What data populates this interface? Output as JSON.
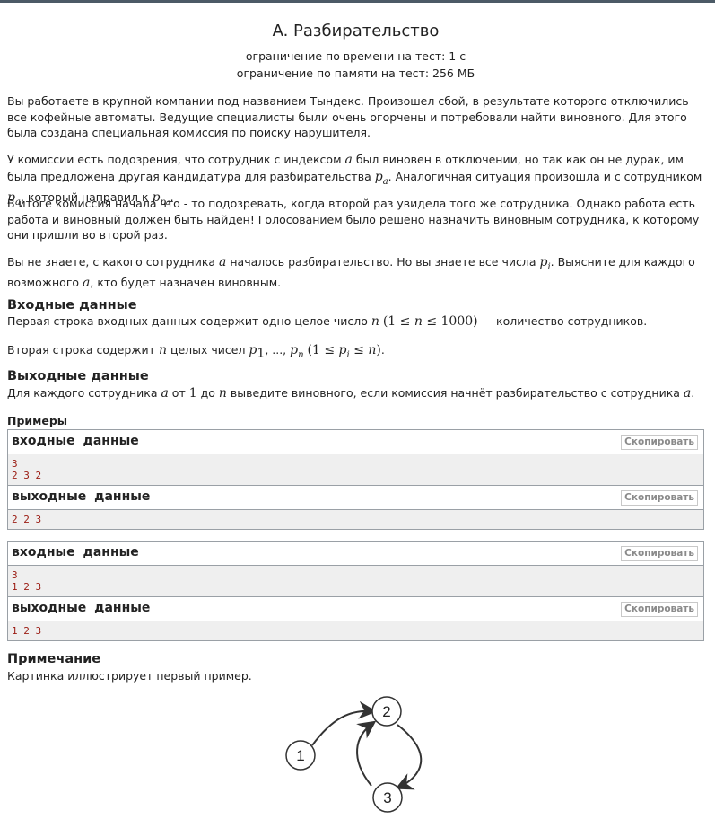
{
  "problem": {
    "title": "A. Разбирательство",
    "time_limit": "ограничение по времени на тест: 1 с",
    "memory_limit": "ограничение по памяти на тест: 256 МБ"
  },
  "statement": {
    "p1": "Вы работаете в крупной компании под названием Тындекс. Произошел сбой, в результате которого отключились все кофейные автоматы. Ведущие специалисты были очень огорчены и потребовали найти виновного. Для этого была создана специальная комиссия по поиску нарушителя.",
    "p2_a": "У комиссии есть подозрения, что сотрудник с индексом ",
    "p2_b": " был виновен в отключении, но так как он не дурак, им была предложена другая кандидатура для разбирательства ",
    "p2_c": ". Аналогичная ситуация произошла и с сотрудником ",
    "p2_d": ", который направил к ",
    "p2_e": ".",
    "p3": "В итоге комиссия начала что - то подозревать, когда второй раз увидела того же сотрудника. Однако работа есть работа и виновный должен быть найден! Голосованием было решено назначить виновным сотрудника, к которому они пришли во второй раз.",
    "p4_a": "Вы не знаете, с какого сотрудника ",
    "p4_b": " началось разбирательство. Но вы знаете все числа ",
    "p4_c": ". Выясните для каждого возможного ",
    "p4_d": ", кто будет назначен виновным."
  },
  "input_section": {
    "title": "Входные данные",
    "l1_a": "Первая строка входных данных содержит одно целое число ",
    "l1_b": " — количество сотрудников.",
    "l2_a": "Вторая строка содержит ",
    "l2_b": " целых чисел "
  },
  "output_section": {
    "title": "Выходные данные",
    "l1_a": "Для каждого сотрудника ",
    "l1_b": " от ",
    "l1_c": " до ",
    "l1_d": " выведите виновного, если комиссия начнёт разбирательство с сотрудника ",
    "l1_e": "."
  },
  "examples": {
    "label": "Примеры",
    "input_label": "входные данные",
    "output_label": "выходные данные",
    "copy_label": "Скопировать",
    "samples": [
      {
        "input": "3\n2 3 2",
        "output": "2 2 3"
      },
      {
        "input": "3\n1 2 3",
        "output": "1 2 3"
      }
    ]
  },
  "note": {
    "title": "Примечание",
    "text": "Картинка иллюстрирует первый пример.",
    "nodes": [
      "1",
      "2",
      "3"
    ]
  }
}
